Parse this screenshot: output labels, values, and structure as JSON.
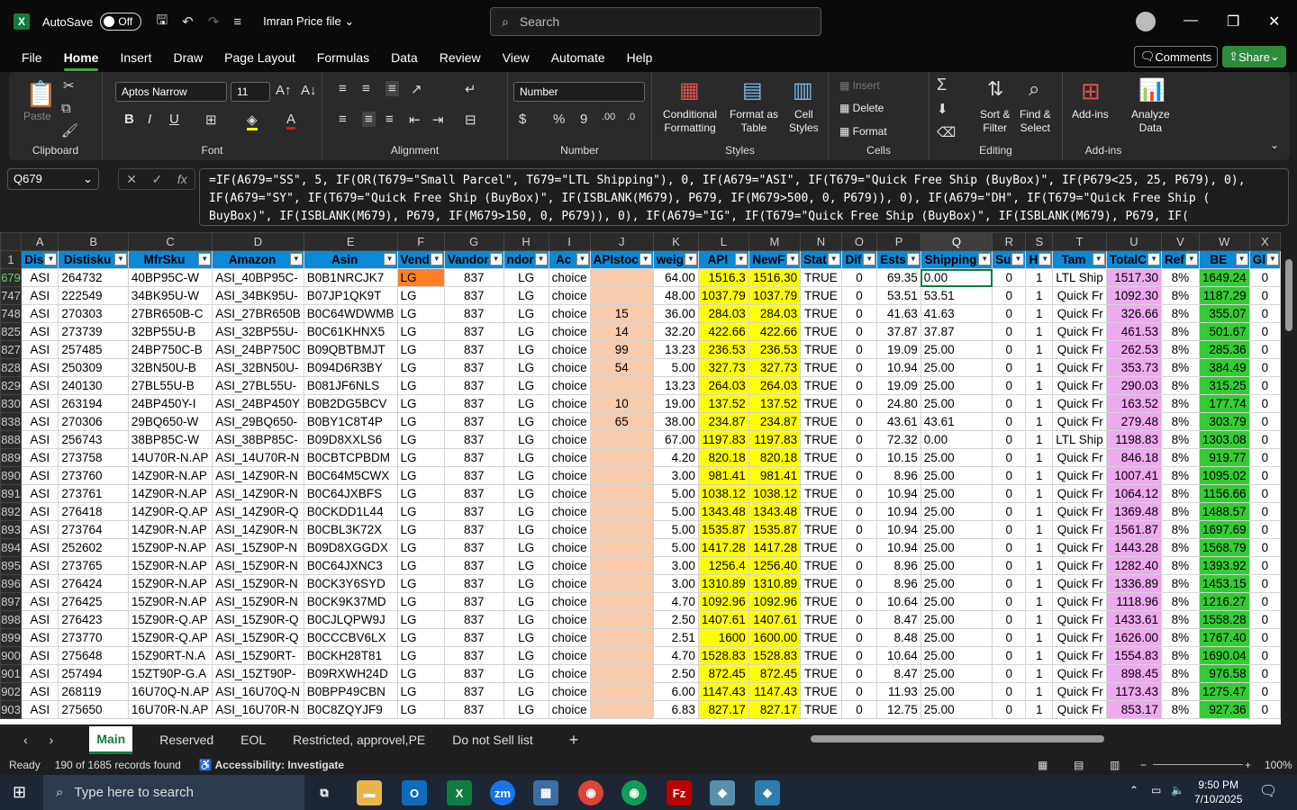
{
  "titlebar": {
    "autosave": "AutoSave",
    "toggle": "Off",
    "filename": "Imran Price file",
    "search_placeholder": "Search"
  },
  "menus": [
    "File",
    "Home",
    "Insert",
    "Draw",
    "Page Layout",
    "Formulas",
    "Data",
    "Review",
    "View",
    "Automate",
    "Help"
  ],
  "active_menu": "Home",
  "comments": "Comments",
  "share": "Share",
  "ribbon": {
    "clipboard": {
      "label": "Clipboard",
      "paste": "Paste"
    },
    "font": {
      "label": "Font",
      "name": "Aptos Narrow",
      "size": "11"
    },
    "alignment": {
      "label": "Alignment"
    },
    "number": {
      "label": "Number",
      "format": "Number"
    },
    "styles": {
      "label": "Styles",
      "conditional": "Conditional\nFormatting",
      "format_table": "Format as\nTable",
      "cell_styles": "Cell\nStyles"
    },
    "cells": {
      "label": "Cells",
      "insert": "Insert",
      "delete": "Delete",
      "format": "Format"
    },
    "editing": {
      "label": "Editing",
      "sort": "Sort &\nFilter",
      "find": "Find &\nSelect"
    },
    "addins": {
      "label": "Add-ins",
      "addins": "Add-ins",
      "analyze": "Analyze\nData"
    }
  },
  "namebox": "Q679",
  "formula": "=IF(A679=\"SS\", 5, IF(OR(T679=\"Small Parcel\", T679=\"LTL Shipping\"), 0, IF(A679=\"ASI\", IF(T679=\"Quick Free Ship (BuyBox)\", IF(P679<25, 25, P679), 0),\nIF(A679=\"SY\", IF(T679=\"Quick Free Ship (BuyBox)\", IF(ISBLANK(M679), P679, IF(M679>500, 0, P679)), 0), IF(A679=\"DH\", IF(T679=\"Quick Free Ship (\nBuyBox)\", IF(ISBLANK(M679), P679, IF(M679>150, 0, P679)), 0), IF(A679=\"IG\", IF(T679=\"Quick Free Ship (BuyBox)\", IF(ISBLANK(M679), P679, IF(",
  "columns": [
    "A",
    "B",
    "C",
    "D",
    "E",
    "F",
    "G",
    "H",
    "I",
    "J",
    "K",
    "L",
    "M",
    "N",
    "O",
    "P",
    "Q",
    "R",
    "S",
    "T",
    "U",
    "V",
    "W",
    "X"
  ],
  "headers": [
    "Dis",
    "Distisku",
    "MfrSku",
    "Amazon",
    "Asin",
    "Vend",
    "Vandor",
    "ndor",
    "Ac",
    "APIstoc",
    "weig",
    "API",
    "NewF",
    "Stat",
    "Dif",
    "Ests",
    "Shipping",
    "Su",
    "H",
    "Tam",
    "TotalC",
    "Ref",
    "BE",
    "Gl"
  ],
  "rows": [
    {
      "n": "679",
      "c": [
        "ASI",
        "264732",
        "40BP95C-W",
        "ASI_40BP95C-",
        "B0B1NRCJK7",
        "LG",
        "837",
        "LG",
        "choice",
        "",
        "64.00",
        "1516.3",
        "1516.30",
        "TRUE",
        "0",
        "69.35",
        "0.00",
        "0",
        "1",
        "LTL Ship",
        "1517.30",
        "8%",
        "1649.24",
        "0"
      ]
    },
    {
      "n": "747",
      "c": [
        "ASI",
        "222549",
        "34BK95U-W",
        "ASI_34BK95U-",
        "B07JP1QK9T",
        "LG",
        "837",
        "LG",
        "choice",
        "",
        "48.00",
        "1037.79",
        "1037.79",
        "TRUE",
        "0",
        "53.51",
        "53.51",
        "0",
        "1",
        "Quick Fr",
        "1092.30",
        "8%",
        "1187.29",
        "0"
      ]
    },
    {
      "n": "748",
      "c": [
        "ASI",
        "270303",
        "27BR650B-C",
        "ASI_27BR650B",
        "B0C64WDWMB",
        "LG",
        "837",
        "LG",
        "choice",
        "15",
        "36.00",
        "284.03",
        "284.03",
        "TRUE",
        "0",
        "41.63",
        "41.63",
        "0",
        "1",
        "Quick Fr",
        "326.66",
        "8%",
        "355.07",
        "0"
      ]
    },
    {
      "n": "825",
      "c": [
        "ASI",
        "273739",
        "32BP55U-B",
        "ASI_32BP55U-",
        "B0C61KHNX5",
        "LG",
        "837",
        "LG",
        "choice",
        "14",
        "32.20",
        "422.66",
        "422.66",
        "TRUE",
        "0",
        "37.87",
        "37.87",
        "0",
        "1",
        "Quick Fr",
        "461.53",
        "8%",
        "501.67",
        "0"
      ]
    },
    {
      "n": "827",
      "c": [
        "ASI",
        "257485",
        "24BP750C-B",
        "ASI_24BP750C",
        "B09QBTBMJT",
        "LG",
        "837",
        "LG",
        "choice",
        "99",
        "13.23",
        "236.53",
        "236.53",
        "TRUE",
        "0",
        "19.09",
        "25.00",
        "0",
        "1",
        "Quick Fr",
        "262.53",
        "8%",
        "285.36",
        "0"
      ]
    },
    {
      "n": "828",
      "c": [
        "ASI",
        "250309",
        "32BN50U-B",
        "ASI_32BN50U-",
        "B094D6R3BY",
        "LG",
        "837",
        "LG",
        "choice",
        "54",
        "5.00",
        "327.73",
        "327.73",
        "TRUE",
        "0",
        "10.94",
        "25.00",
        "0",
        "1",
        "Quick Fr",
        "353.73",
        "8%",
        "384.49",
        "0"
      ]
    },
    {
      "n": "829",
      "c": [
        "ASI",
        "240130",
        "27BL55U-B",
        "ASI_27BL55U-",
        "B081JF6NLS",
        "LG",
        "837",
        "LG",
        "choice",
        "",
        "13.23",
        "264.03",
        "264.03",
        "TRUE",
        "0",
        "19.09",
        "25.00",
        "0",
        "1",
        "Quick Fr",
        "290.03",
        "8%",
        "315.25",
        "0"
      ]
    },
    {
      "n": "830",
      "c": [
        "ASI",
        "263194",
        "24BP450Y-I",
        "ASI_24BP450Y",
        "B0B2DG5BCV",
        "LG",
        "837",
        "LG",
        "choice",
        "10",
        "19.00",
        "137.52",
        "137.52",
        "TRUE",
        "0",
        "24.80",
        "25.00",
        "0",
        "1",
        "Quick Fr",
        "163.52",
        "8%",
        "177.74",
        "0"
      ]
    },
    {
      "n": "838",
      "c": [
        "ASI",
        "270306",
        "29BQ650-W",
        "ASI_29BQ650-",
        "B0BY1C8T4P",
        "LG",
        "837",
        "LG",
        "choice",
        "65",
        "38.00",
        "234.87",
        "234.87",
        "TRUE",
        "0",
        "43.61",
        "43.61",
        "0",
        "1",
        "Quick Fr",
        "279.48",
        "8%",
        "303.79",
        "0"
      ]
    },
    {
      "n": "888",
      "c": [
        "ASI",
        "256743",
        "38BP85C-W",
        "ASI_38BP85C-",
        "B09D8XXLS6",
        "LG",
        "837",
        "LG",
        "choice",
        "",
        "67.00",
        "1197.83",
        "1197.83",
        "TRUE",
        "0",
        "72.32",
        "0.00",
        "0",
        "1",
        "LTL Ship",
        "1198.83",
        "8%",
        "1303.08",
        "0"
      ]
    },
    {
      "n": "889",
      "c": [
        "ASI",
        "273758",
        "14U70R-N.AP",
        "ASI_14U70R-N",
        "B0CBTCPBDM",
        "LG",
        "837",
        "LG",
        "choice",
        "",
        "4.20",
        "820.18",
        "820.18",
        "TRUE",
        "0",
        "10.15",
        "25.00",
        "0",
        "1",
        "Quick Fr",
        "846.18",
        "8%",
        "919.77",
        "0"
      ]
    },
    {
      "n": "890",
      "c": [
        "ASI",
        "273760",
        "14Z90R-N.AP",
        "ASI_14Z90R-N",
        "B0C64M5CWX",
        "LG",
        "837",
        "LG",
        "choice",
        "",
        "3.00",
        "981.41",
        "981.41",
        "TRUE",
        "0",
        "8.96",
        "25.00",
        "0",
        "1",
        "Quick Fr",
        "1007.41",
        "8%",
        "1095.02",
        "0"
      ]
    },
    {
      "n": "891",
      "c": [
        "ASI",
        "273761",
        "14Z90R-N.AP",
        "ASI_14Z90R-N",
        "B0C64JXBFS",
        "LG",
        "837",
        "LG",
        "choice",
        "",
        "5.00",
        "1038.12",
        "1038.12",
        "TRUE",
        "0",
        "10.94",
        "25.00",
        "0",
        "1",
        "Quick Fr",
        "1064.12",
        "8%",
        "1156.66",
        "0"
      ]
    },
    {
      "n": "892",
      "c": [
        "ASI",
        "276418",
        "14Z90R-Q.AP",
        "ASI_14Z90R-Q",
        "B0CKDD1L44",
        "LG",
        "837",
        "LG",
        "choice",
        "",
        "5.00",
        "1343.48",
        "1343.48",
        "TRUE",
        "0",
        "10.94",
        "25.00",
        "0",
        "1",
        "Quick Fr",
        "1369.48",
        "8%",
        "1488.57",
        "0"
      ]
    },
    {
      "n": "893",
      "c": [
        "ASI",
        "273764",
        "14Z90R-N.AP",
        "ASI_14Z90R-N",
        "B0CBL3K72X",
        "LG",
        "837",
        "LG",
        "choice",
        "",
        "5.00",
        "1535.87",
        "1535.87",
        "TRUE",
        "0",
        "10.94",
        "25.00",
        "0",
        "1",
        "Quick Fr",
        "1561.87",
        "8%",
        "1697.69",
        "0"
      ]
    },
    {
      "n": "894",
      "c": [
        "ASI",
        "252602",
        "15Z90P-N.AP",
        "ASI_15Z90P-N",
        "B09D8XGGDX",
        "LG",
        "837",
        "LG",
        "choice",
        "",
        "5.00",
        "1417.28",
        "1417.28",
        "TRUE",
        "0",
        "10.94",
        "25.00",
        "0",
        "1",
        "Quick Fr",
        "1443.28",
        "8%",
        "1568.79",
        "0"
      ]
    },
    {
      "n": "895",
      "c": [
        "ASI",
        "273765",
        "15Z90R-N.AP",
        "ASI_15Z90R-N",
        "B0C64JXNC3",
        "LG",
        "837",
        "LG",
        "choice",
        "",
        "3.00",
        "1256.4",
        "1256.40",
        "TRUE",
        "0",
        "8.96",
        "25.00",
        "0",
        "1",
        "Quick Fr",
        "1282.40",
        "8%",
        "1393.92",
        "0"
      ]
    },
    {
      "n": "896",
      "c": [
        "ASI",
        "276424",
        "15Z90R-N.AP",
        "ASI_15Z90R-N",
        "B0CK3Y6SYD",
        "LG",
        "837",
        "LG",
        "choice",
        "",
        "3.00",
        "1310.89",
        "1310.89",
        "TRUE",
        "0",
        "8.96",
        "25.00",
        "0",
        "1",
        "Quick Fr",
        "1336.89",
        "8%",
        "1453.15",
        "0"
      ]
    },
    {
      "n": "897",
      "c": [
        "ASI",
        "276425",
        "15Z90R-N.AP",
        "ASI_15Z90R-N",
        "B0CK9K37MD",
        "LG",
        "837",
        "LG",
        "choice",
        "",
        "4.70",
        "1092.96",
        "1092.96",
        "TRUE",
        "0",
        "10.64",
        "25.00",
        "0",
        "1",
        "Quick Fr",
        "1118.96",
        "8%",
        "1216.27",
        "0"
      ]
    },
    {
      "n": "898",
      "c": [
        "ASI",
        "276423",
        "15Z90R-Q.AP",
        "ASI_15Z90R-Q",
        "B0CJLQPW9J",
        "LG",
        "837",
        "LG",
        "choice",
        "",
        "2.50",
        "1407.61",
        "1407.61",
        "TRUE",
        "0",
        "8.47",
        "25.00",
        "0",
        "1",
        "Quick Fr",
        "1433.61",
        "8%",
        "1558.28",
        "0"
      ]
    },
    {
      "n": "899",
      "c": [
        "ASI",
        "273770",
        "15Z90R-Q.AP",
        "ASI_15Z90R-Q",
        "B0CCCBV6LX",
        "LG",
        "837",
        "LG",
        "choice",
        "",
        "2.51",
        "1600",
        "1600.00",
        "TRUE",
        "0",
        "8.48",
        "25.00",
        "0",
        "1",
        "Quick Fr",
        "1626.00",
        "8%",
        "1767.40",
        "0"
      ]
    },
    {
      "n": "900",
      "c": [
        "ASI",
        "275648",
        "15Z90RT-N.A",
        "ASI_15Z90RT-",
        "B0CKH28T81",
        "LG",
        "837",
        "LG",
        "choice",
        "",
        "4.70",
        "1528.83",
        "1528.83",
        "TRUE",
        "0",
        "10.64",
        "25.00",
        "0",
        "1",
        "Quick Fr",
        "1554.83",
        "8%",
        "1690.04",
        "0"
      ]
    },
    {
      "n": "901",
      "c": [
        "ASI",
        "257494",
        "15ZT90P-G.A",
        "ASI_15ZT90P-",
        "B09RXWH24D",
        "LG",
        "837",
        "LG",
        "choice",
        "",
        "2.50",
        "872.45",
        "872.45",
        "TRUE",
        "0",
        "8.47",
        "25.00",
        "0",
        "1",
        "Quick Fr",
        "898.45",
        "8%",
        "976.58",
        "0"
      ]
    },
    {
      "n": "902",
      "c": [
        "ASI",
        "268119",
        "16U70Q-N.AP",
        "ASI_16U70Q-N",
        "B0BPP49CBN",
        "LG",
        "837",
        "LG",
        "choice",
        "",
        "6.00",
        "1147.43",
        "1147.43",
        "TRUE",
        "0",
        "11.93",
        "25.00",
        "0",
        "1",
        "Quick Fr",
        "1173.43",
        "8%",
        "1275.47",
        "0"
      ]
    },
    {
      "n": "903",
      "c": [
        "ASI",
        "275650",
        "16U70R-N.AP",
        "ASI_16U70R-N",
        "B0C8ZQYJF9",
        "LG",
        "837",
        "LG",
        "choice",
        "",
        "6.83",
        "827.17",
        "827.17",
        "TRUE",
        "0",
        "12.75",
        "25.00",
        "0",
        "1",
        "Quick Fr",
        "853.17",
        "8%",
        "927.36",
        "0"
      ]
    }
  ],
  "sheets": [
    "Main",
    "Reserved",
    "EOL",
    "Restricted, approvel,PE",
    "Do not Sell list"
  ],
  "active_sheet": "Main",
  "status": {
    "ready": "Ready",
    "records": "190 of 1685 records found",
    "accessibility": "Accessibility: Investigate",
    "zoom": "100%"
  },
  "taskbar": {
    "search_placeholder": "Type here to search",
    "time": "9:50 PM",
    "date": "7/10/2025"
  },
  "colors": {
    "header": "#0c89d6",
    "api": "#ffff00",
    "stock": "#f8cbad",
    "total": "#eeaaee",
    "be": "#33cc33",
    "vendor_active": "#ff7f27"
  }
}
